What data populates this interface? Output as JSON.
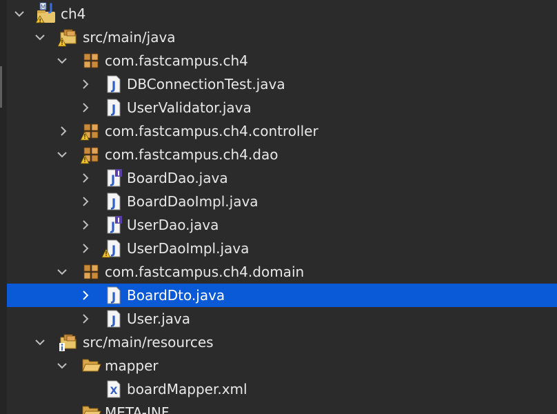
{
  "explorer": {
    "rows": [
      {
        "label": "ch4",
        "type": "project",
        "expanded": true
      },
      {
        "label": "src/main/java",
        "type": "source-folder",
        "expanded": true
      },
      {
        "label": "com.fastcampus.ch4",
        "type": "package",
        "expanded": true
      },
      {
        "label": "DBConnectionTest.java",
        "type": "java-class",
        "expanded": false
      },
      {
        "label": "UserValidator.java",
        "type": "java-class",
        "expanded": false
      },
      {
        "label": "com.fastcampus.ch4.controller",
        "type": "package-warning",
        "expanded": false
      },
      {
        "label": "com.fastcampus.ch4.dao",
        "type": "package-warning",
        "expanded": true
      },
      {
        "label": "BoardDao.java",
        "type": "java-interface",
        "expanded": false
      },
      {
        "label": "BoardDaoImpl.java",
        "type": "java-class",
        "expanded": false
      },
      {
        "label": "UserDao.java",
        "type": "java-interface",
        "expanded": false
      },
      {
        "label": "UserDaoImpl.java",
        "type": "java-class-warning",
        "expanded": false
      },
      {
        "label": "com.fastcampus.ch4.domain",
        "type": "package",
        "expanded": true
      },
      {
        "label": "BoardDto.java",
        "type": "java-class",
        "expanded": false,
        "selected": true
      },
      {
        "label": "User.java",
        "type": "java-class",
        "expanded": false
      },
      {
        "label": "src/main/resources",
        "type": "resource-folder",
        "expanded": true
      },
      {
        "label": "mapper",
        "type": "folder-open",
        "expanded": true
      },
      {
        "label": "boardMapper.xml",
        "type": "xml-file",
        "expanded": null
      },
      {
        "label": "META-INF",
        "type": "folder-open",
        "expanded": null
      }
    ]
  },
  "colors": {
    "background": "#2b2b2b",
    "selection": "#0a59d6",
    "text": "#e8e8e8",
    "warning": "#f2c230"
  }
}
